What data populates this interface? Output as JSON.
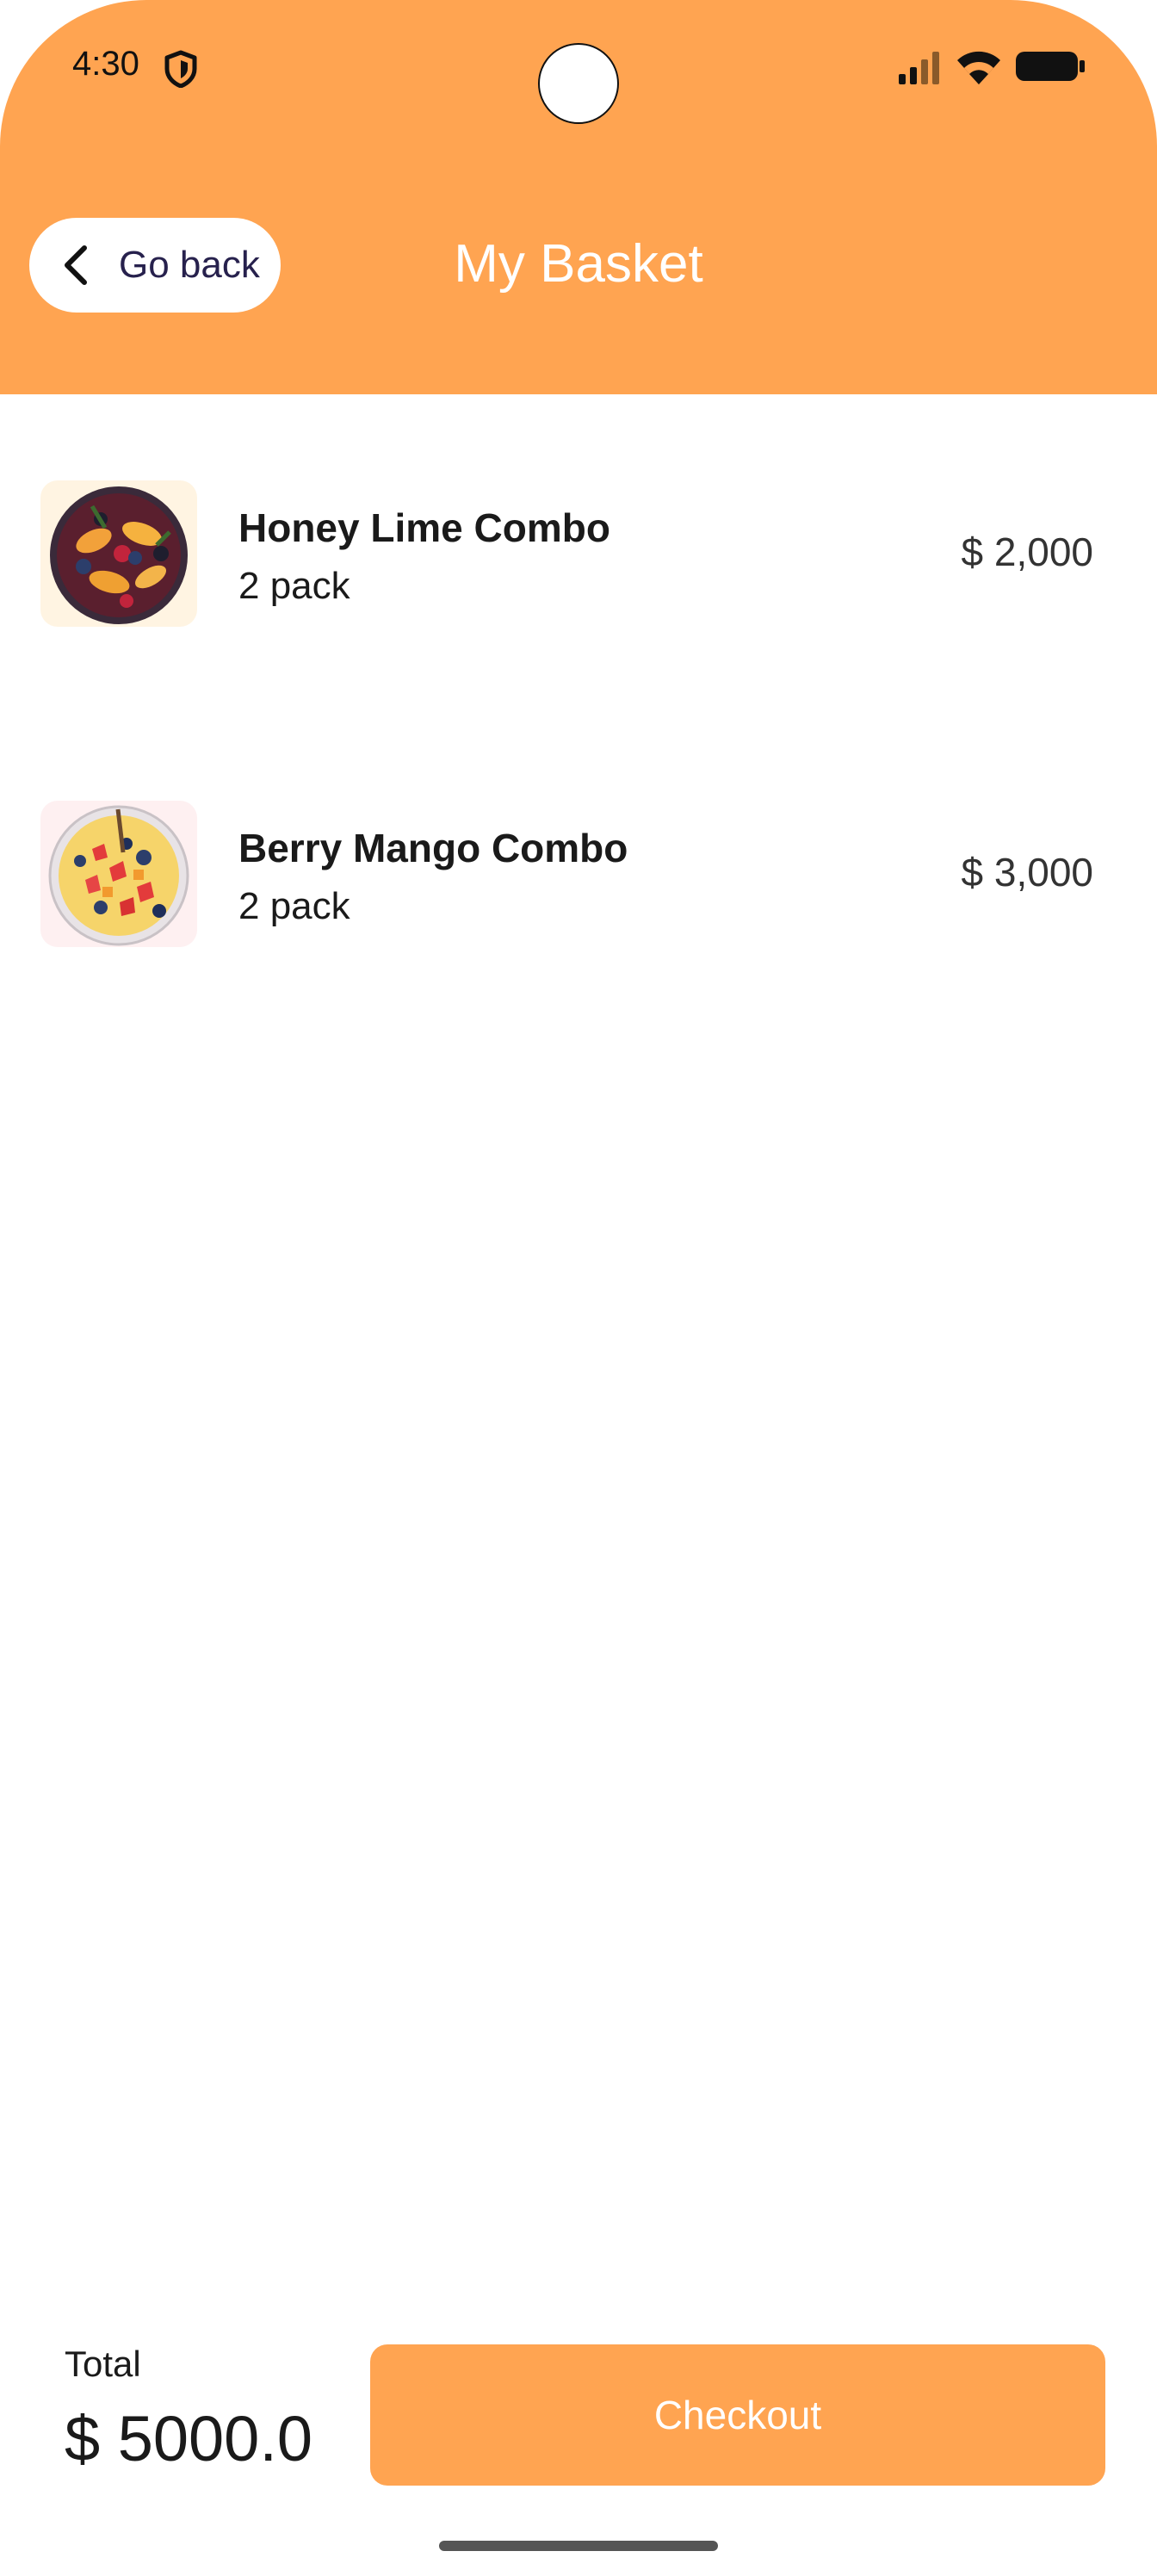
{
  "status_bar": {
    "time": "4:30"
  },
  "header": {
    "back_label": "Go back",
    "title": "My Basket"
  },
  "items": [
    {
      "name": "Honey Lime Combo",
      "quantity": "2 pack",
      "price": "$ 2,000"
    },
    {
      "name": "Berry Mango Combo",
      "quantity": "2 pack",
      "price": "$ 3,000"
    }
  ],
  "footer": {
    "total_label": "Total",
    "total_value": "$ 5000.0",
    "checkout_label": "Checkout"
  },
  "colors": {
    "accent": "#FFA451",
    "header_text": "#FFFFFF",
    "back_text": "#27214D"
  },
  "icons": [
    "shield-icon",
    "cellular-signal-icon",
    "wifi-icon",
    "battery-icon",
    "chevron-left-icon"
  ]
}
